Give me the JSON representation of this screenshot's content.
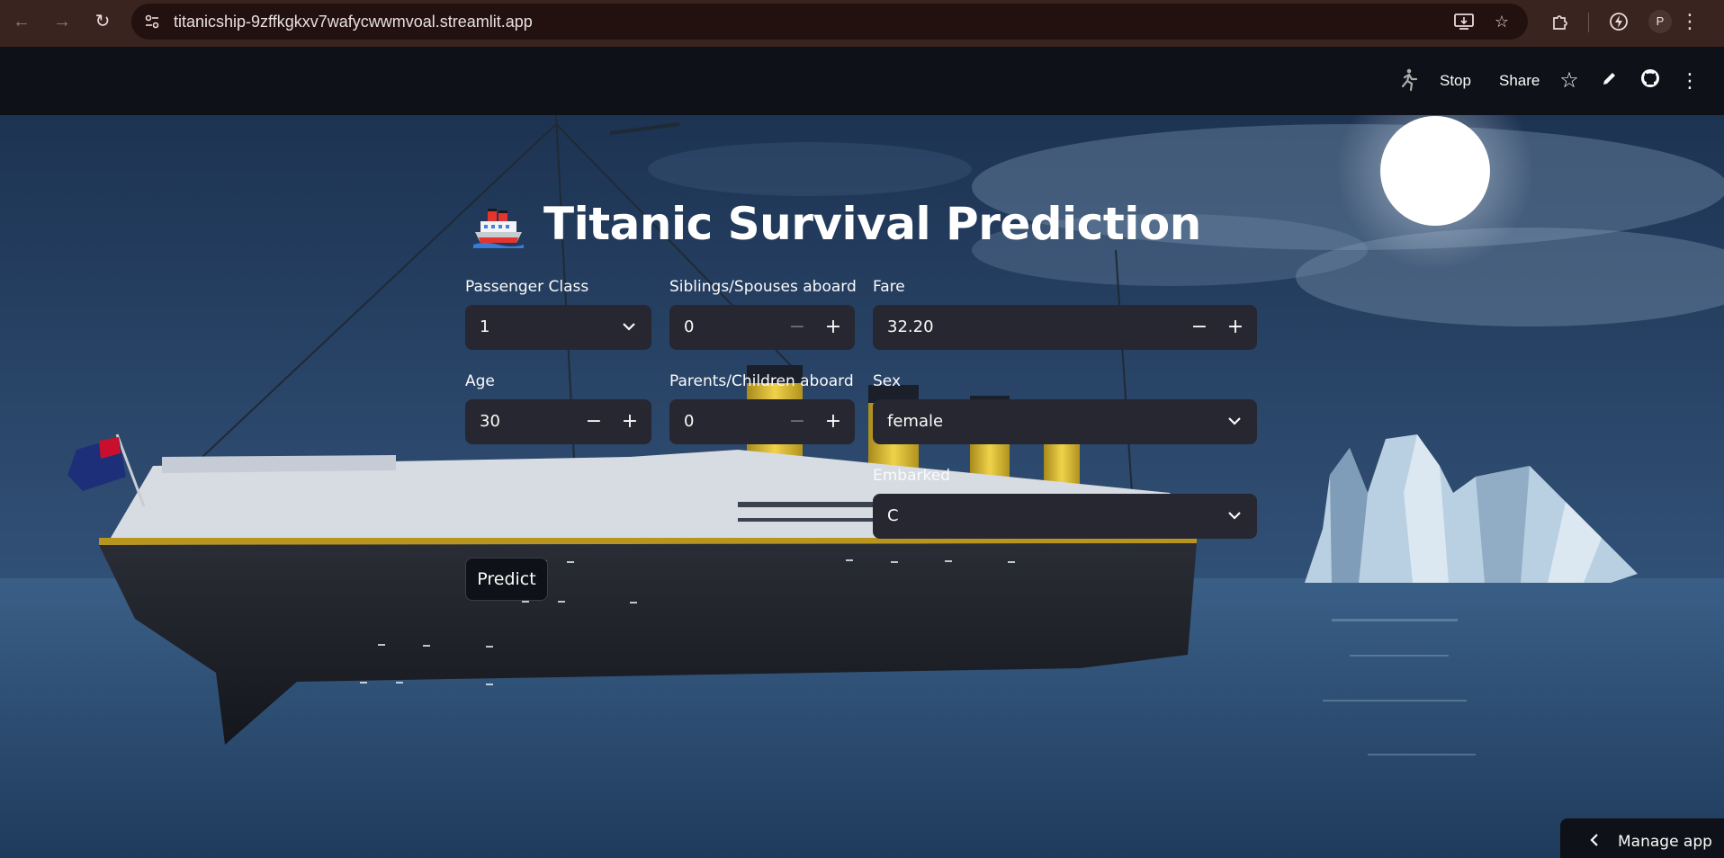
{
  "browser": {
    "url": "titanicship-9zffkgkxv7wafycwwmvoal.streamlit.app",
    "profile_initial": "P"
  },
  "header": {
    "stop_label": "Stop",
    "share_label": "Share"
  },
  "page": {
    "title": "Titanic Survival Prediction",
    "title_emoji": "ship-emoji"
  },
  "form": {
    "passenger_class": {
      "label": "Passenger Class",
      "value": "1"
    },
    "siblings_spouses": {
      "label": "Siblings/Spouses aboard",
      "value": "0"
    },
    "fare": {
      "label": "Fare",
      "value": "32.20"
    },
    "age": {
      "label": "Age",
      "value": "30"
    },
    "parents_children": {
      "label": "Parents/Children aboard",
      "value": "0"
    },
    "sex": {
      "label": "Sex",
      "value": "female"
    },
    "embarked": {
      "label": "Embarked",
      "value": "C"
    },
    "minus_glyph": "−",
    "plus_glyph": "+",
    "predict_label": "Predict"
  },
  "footer": {
    "manage_label": "Manage app"
  },
  "colors": {
    "input_bg": "#262730",
    "app_bg": "#0e1117",
    "browser_bar": "#3a2420"
  }
}
